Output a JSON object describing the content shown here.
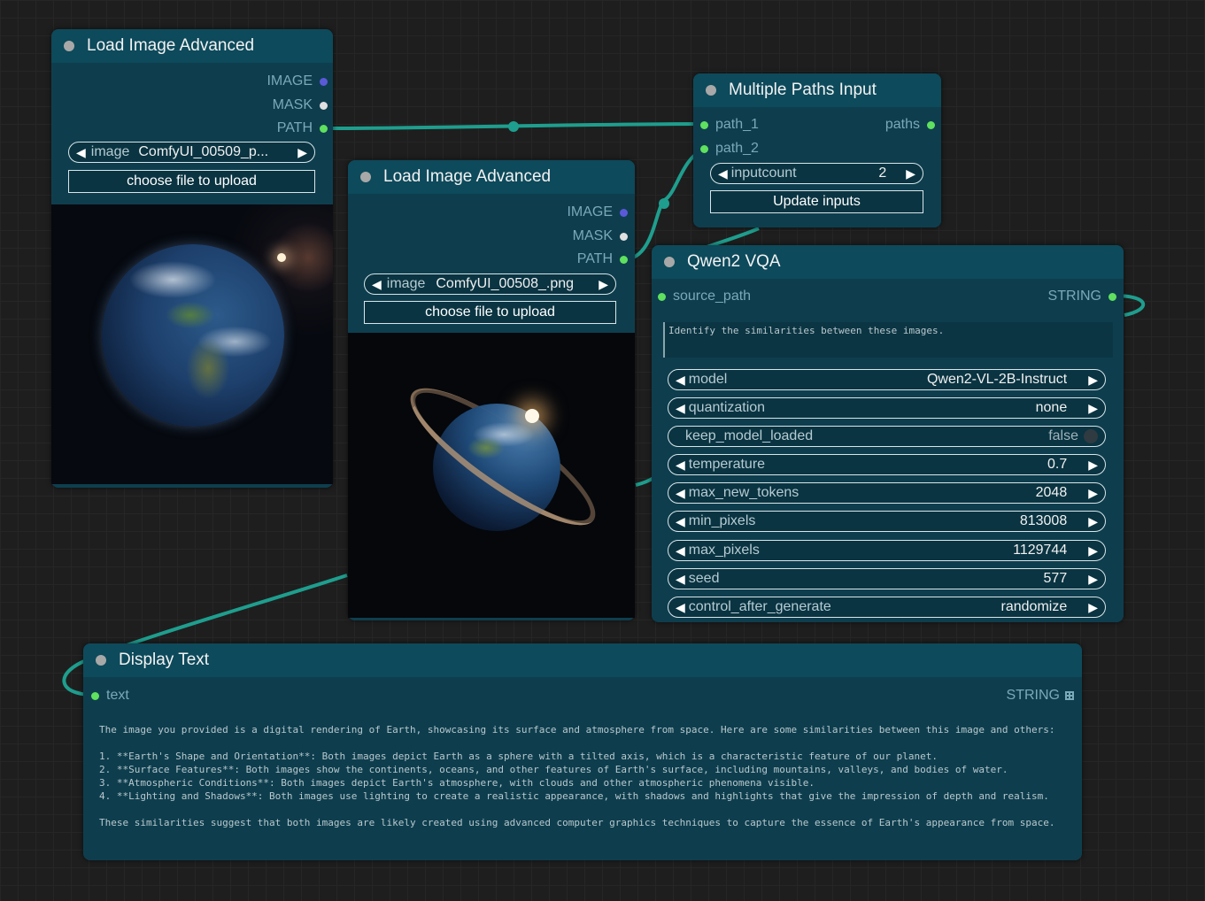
{
  "canvas": {
    "background": "#1e1e1e"
  },
  "colors": {
    "wire": "#1e9e8e",
    "image_slot": "#5a5ad8",
    "mask_slot": "#e0e0e0",
    "string_slot": "#5fe05f"
  },
  "load1": {
    "title": "Load Image Advanced",
    "outputs": [
      "IMAGE",
      "MASK",
      "PATH"
    ],
    "image_label": "image",
    "image_value": "ComfyUI_00509_p...",
    "upload_button": "choose file to upload"
  },
  "load2": {
    "title": "Load Image Advanced",
    "outputs": [
      "IMAGE",
      "MASK",
      "PATH"
    ],
    "image_label": "image",
    "image_value": "ComfyUI_00508_.png",
    "upload_button": "choose file to upload"
  },
  "paths": {
    "title": "Multiple Paths Input",
    "inputs": [
      "path_1",
      "path_2"
    ],
    "output": "paths",
    "count_label": "inputcount",
    "count_value": "2",
    "update_button": "Update inputs"
  },
  "qwen": {
    "title": "Qwen2 VQA",
    "input": "source_path",
    "output": "STRING",
    "prompt": "Identify the similarities between these images.",
    "widgets": [
      {
        "label": "model",
        "value": "Qwen2-VL-2B-Instruct"
      },
      {
        "label": "quantization",
        "value": "none"
      },
      {
        "label": "keep_model_loaded",
        "value": "false"
      },
      {
        "label": "temperature",
        "value": "0.7"
      },
      {
        "label": "max_new_tokens",
        "value": "2048"
      },
      {
        "label": "min_pixels",
        "value": "813008"
      },
      {
        "label": "max_pixels",
        "value": "1129744"
      },
      {
        "label": "seed",
        "value": "577"
      },
      {
        "label": "control_after_generate",
        "value": "randomize"
      }
    ]
  },
  "display": {
    "title": "Display Text",
    "input": "text",
    "output": "STRING",
    "content": "The image you provided is a digital rendering of Earth, showcasing its surface and atmosphere from space. Here are some similarities between this image and others:\n\n1. **Earth's Shape and Orientation**: Both images depict Earth as a sphere with a tilted axis, which is a characteristic feature of our planet.\n2. **Surface Features**: Both images show the continents, oceans, and other features of Earth's surface, including mountains, valleys, and bodies of water.\n3. **Atmospheric Conditions**: Both images depict Earth's atmosphere, with clouds and other atmospheric phenomena visible.\n4. **Lighting and Shadows**: Both images use lighting to create a realistic appearance, with shadows and highlights that give the impression of depth and realism.\n\nThese similarities suggest that both images are likely created using advanced computer graphics techniques to capture the essence of Earth's appearance from space."
  }
}
